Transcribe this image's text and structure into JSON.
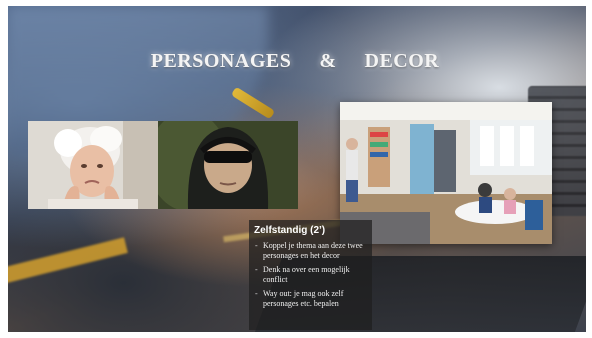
{
  "slide": {
    "title_left": "PERSONAGES",
    "title_amp": "&",
    "title_right": "DECOR"
  },
  "images": {
    "left": "old-woman-photo",
    "middle": "hooded-young-man-photo",
    "right": "library-interior-photo"
  },
  "info": {
    "title": "Zelfstandig (2’)",
    "items": [
      "Koppel je thema aan deze twee personages en het decor",
      "Denk na over een mogelijk conflict",
      "Way out: je mag ook zelf personages etc. bepalen"
    ]
  },
  "colors": {
    "title_text": "#f4f4f4",
    "box_background": "#1e1e1e",
    "accent_yellow": "#d4a02e"
  }
}
